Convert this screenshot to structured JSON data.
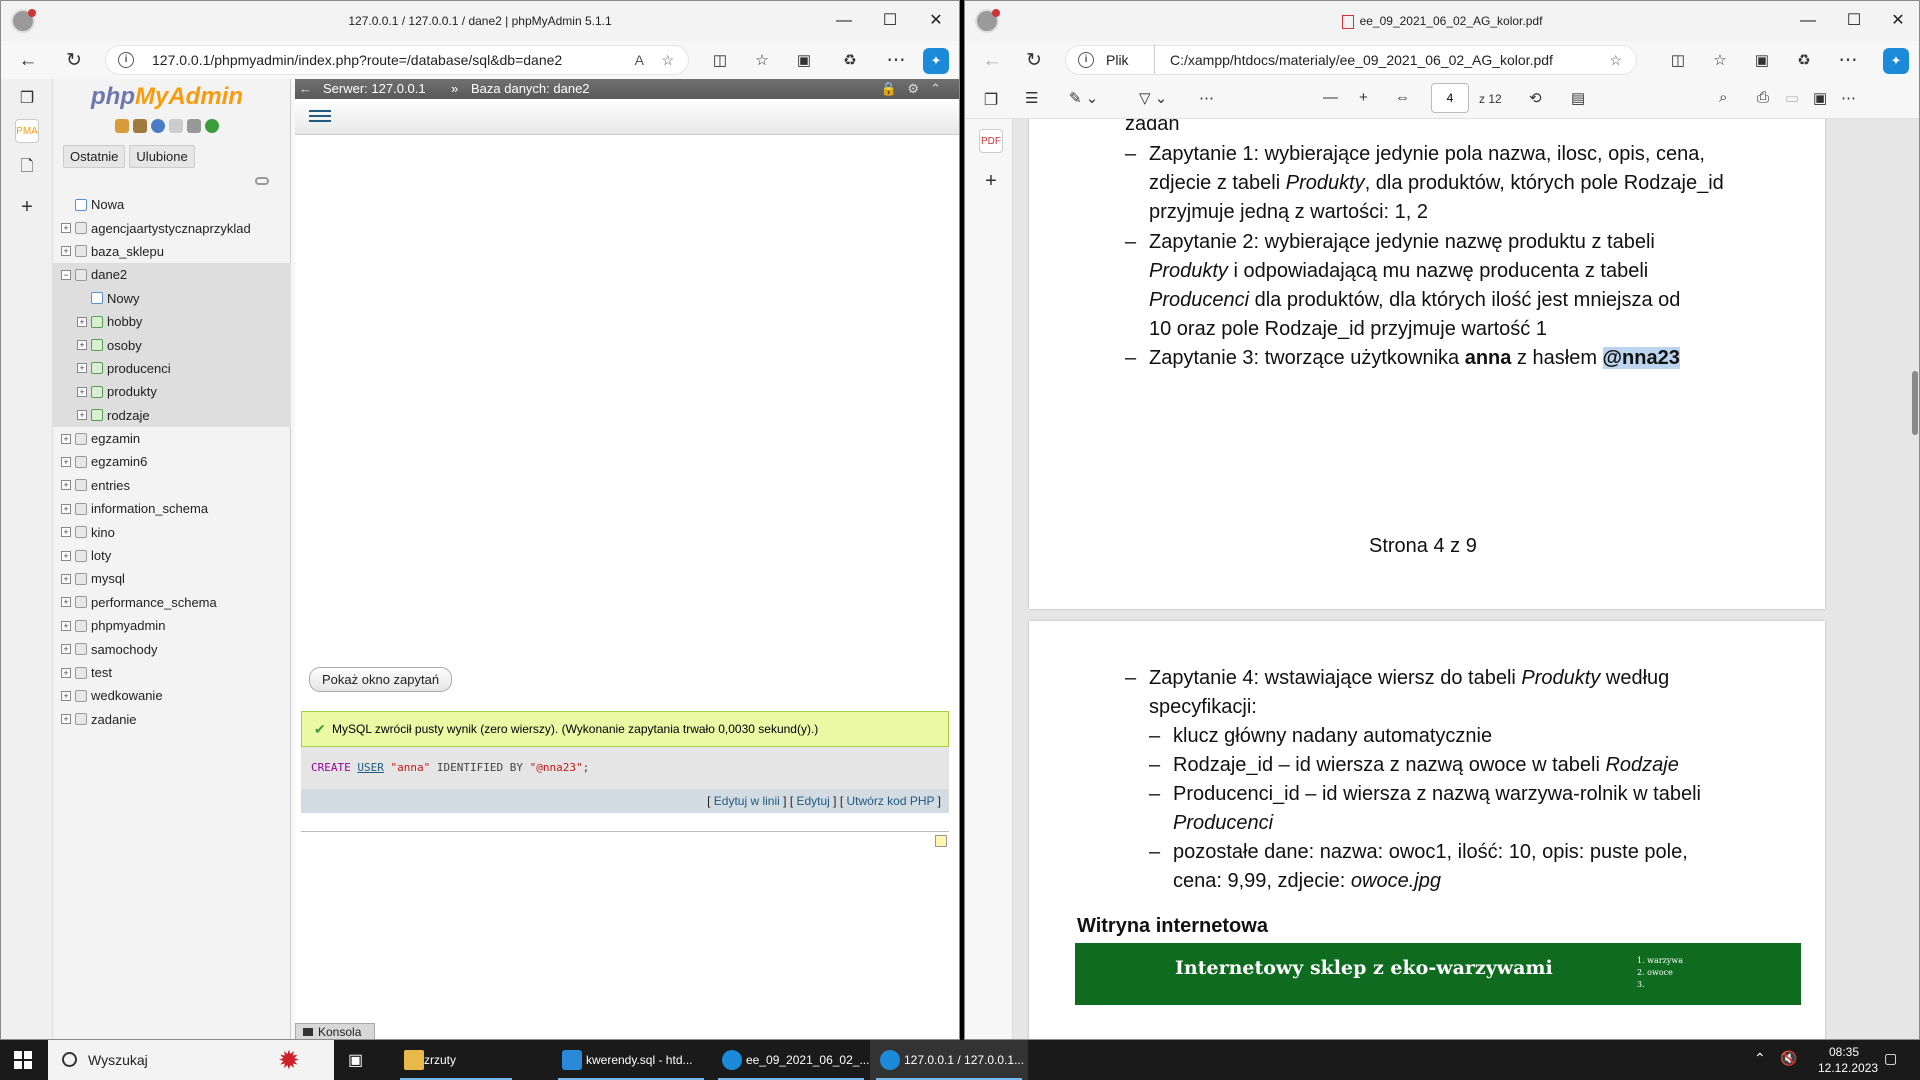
{
  "left_window": {
    "title": "127.0.0.1 / 127.0.0.1 / dane2 | phpMyAdmin 5.1.1",
    "url": "127.0.0.1/phpmyadmin/index.php?route=/database/sql&db=dane2",
    "pma": {
      "logo_php": "php",
      "logo_my": "MyAdmin",
      "tabs": [
        "Ostatnie",
        "Ulubione"
      ],
      "breadcrumb_server": "Serwer: 127.0.0.1",
      "breadcrumb_db": "Baza danych: dane2",
      "tree": [
        {
          "label": "Nowa",
          "level": 0,
          "kind": "new"
        },
        {
          "label": "agencjaartystycznaprzyklad",
          "level": 0,
          "kind": "db"
        },
        {
          "label": "baza_sklepu",
          "level": 0,
          "kind": "db"
        },
        {
          "label": "dane2",
          "level": 0,
          "kind": "db-open",
          "highlight": true
        },
        {
          "label": "Nowy",
          "level": 1,
          "kind": "new",
          "highlight": true
        },
        {
          "label": "hobby",
          "level": 1,
          "kind": "tbl",
          "highlight": true
        },
        {
          "label": "osoby",
          "level": 1,
          "kind": "tbl",
          "highlight": true
        },
        {
          "label": "producenci",
          "level": 1,
          "kind": "tbl",
          "highlight": true
        },
        {
          "label": "produkty",
          "level": 1,
          "kind": "tbl",
          "highlight": true
        },
        {
          "label": "rodzaje",
          "level": 1,
          "kind": "tbl",
          "highlight": true
        },
        {
          "label": "egzamin",
          "level": 0,
          "kind": "db"
        },
        {
          "label": "egzamin6",
          "level": 0,
          "kind": "db"
        },
        {
          "label": "entries",
          "level": 0,
          "kind": "db"
        },
        {
          "label": "information_schema",
          "level": 0,
          "kind": "db"
        },
        {
          "label": "kino",
          "level": 0,
          "kind": "db"
        },
        {
          "label": "loty",
          "level": 0,
          "kind": "db"
        },
        {
          "label": "mysql",
          "level": 0,
          "kind": "db"
        },
        {
          "label": "performance_schema",
          "level": 0,
          "kind": "db"
        },
        {
          "label": "phpmyadmin",
          "level": 0,
          "kind": "db"
        },
        {
          "label": "samochody",
          "level": 0,
          "kind": "db"
        },
        {
          "label": "test",
          "level": 0,
          "kind": "db"
        },
        {
          "label": "wedkowanie",
          "level": 0,
          "kind": "db"
        },
        {
          "label": "zadanie",
          "level": 0,
          "kind": "db"
        }
      ],
      "show_query_button": "Pokaż okno zapytań",
      "result_message": "MySQL zwrócił pusty wynik (zero wierszy). (Wykonanie zapytania trwało 0,0030 sekund(y).)",
      "sql": {
        "kw1": "CREATE",
        "kw2": "USER",
        "user": "\"anna\"",
        "mid": "IDENTIFIED BY",
        "pass": "\"@nna23\"",
        "end": ";"
      },
      "links": [
        "Edytuj w linii",
        "Edytuj",
        "Utwórz kod PHP"
      ],
      "console": "Konsola"
    }
  },
  "right_window": {
    "title": "ee_09_2021_06_02_AG_kolor.pdf",
    "url_label": "Plik",
    "url": "C:/xampp/htdocs/materialy/ee_09_2021_06_02_AG_kolor.pdf",
    "page_current": "4",
    "page_total": "z 12",
    "page1": {
      "line0": "zadań",
      "q1a": "Zapytanie 1: wybierające jedynie pola nazwa, ilosc, opis, cena,",
      "q1b_pre": "zdjecie z tabeli ",
      "q1b_it": "Produkty",
      "q1b_post": ", dla produktów, których pole Rodzaje_id",
      "q1c": "przyjmuje jedną z wartości: 1, 2",
      "q2a": "Zapytanie 2: wybierające jedynie nazwę produktu z tabeli",
      "q2b_it": "Produkty",
      "q2b_post": " i odpowiadającą mu nazwę producenta z tabeli",
      "q2c_it": "Producenci",
      "q2c_post": " dla produktów, dla których ilość jest mniejsza od",
      "q2d": "10 oraz pole Rodzaje_id przyjmuje wartość 1",
      "q3_pre": "Zapytanie 3: tworzące użytkownika ",
      "q3_b1": "anna",
      "q3_mid": " z hasłem ",
      "q3_b2": "@nna23",
      "footer": "Strona 4 z 9"
    },
    "page2": {
      "q4a_pre": "Zapytanie 4: wstawiające wiersz do tabeli ",
      "q4a_it": "Produkty",
      "q4a_post": " według",
      "q4b": "specyfikacji:",
      "s1": "klucz główny nadany automatycznie",
      "s2_pre": "Rodzaje_id – id wiersza z nazwą owoce w tabeli ",
      "s2_it": "Rodzaje",
      "s3": "Producenci_id – id wiersza z nazwą warzywa-rolnik w tabeli",
      "s3b_it": "Producenci",
      "s4a": "pozostałe dane: nazwa: owoc1, ilość: 10, opis: puste pole,",
      "s4b_pre": "cena: 9,99, zdjecie: ",
      "s4b_it": "owoce.jpg",
      "heading": "Witryna internetowa",
      "banner": "Internetowy sklep z eko-warzywami",
      "menu": [
        "1. warzywa",
        "2. owoce",
        "3."
      ]
    }
  },
  "taskbar": {
    "search": "Wyszukaj",
    "apps": [
      "zrzuty",
      "kwerendy.sql - htd...",
      "ee_09_2021_06_02_...",
      "127.0.0.1 / 127.0.0.1..."
    ],
    "time": "08:35",
    "date": "12.12.2023"
  },
  "colors": {
    "pma_blue": "#235a81",
    "pma_green": "#ebf8a4",
    "banner_green": "#0f6b1f"
  }
}
